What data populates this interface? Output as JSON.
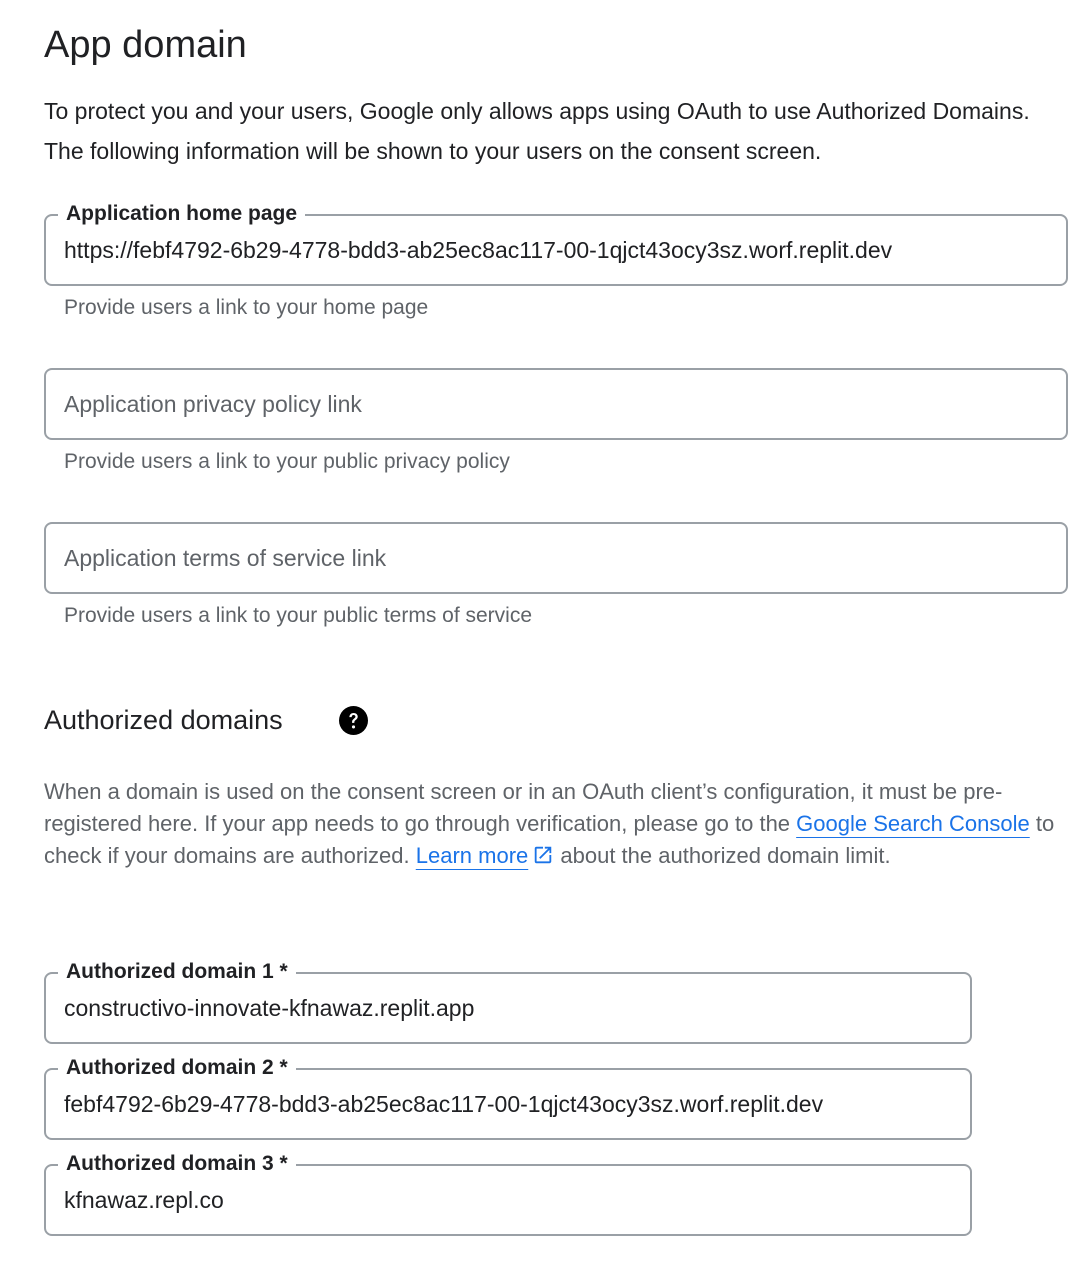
{
  "app_domain": {
    "title": "App domain",
    "intro": "To protect you and your users, Google only allows apps using OAuth to use Authorized Domains. The following information will be shown to your users on the consent screen."
  },
  "home_page": {
    "label": "Application home page",
    "value": "https://febf4792-6b29-4778-bdd3-ab25ec8ac117-00-1qjct43ocy3sz.worf.replit.dev",
    "hint": "Provide users a link to your home page"
  },
  "privacy_policy": {
    "placeholder": "Application privacy policy link",
    "value": "",
    "hint": "Provide users a link to your public privacy policy"
  },
  "terms_of_service": {
    "placeholder": "Application terms of service link",
    "value": "",
    "hint": "Provide users a link to your public terms of service"
  },
  "authorized_domains": {
    "title": "Authorized domains",
    "help_icon": "help-circle-icon",
    "desc_part1": "When a domain is used on the consent screen or in an OAuth client’s configuration, it must be pre-registered here. If your app needs to go through verification, please go to the ",
    "search_console_link": "Google Search Console",
    "desc_part2": " to check if your domains are authorized. ",
    "learn_more_link": "Learn more",
    "external_icon": "open-in-new-icon",
    "desc_part3": " about the authorized domain limit.",
    "link_color": "#1a73e8",
    "domains": [
      {
        "label": "Authorized domain 1 *",
        "value": "constructivo-innovate-kfnawaz.replit.app"
      },
      {
        "label": "Authorized domain 2 *",
        "value": "febf4792-6b29-4778-bdd3-ab25ec8ac117-00-1qjct43ocy3sz.worf.replit.dev"
      },
      {
        "label": "Authorized domain 3 *",
        "value": "kfnawaz.repl.co"
      }
    ]
  }
}
